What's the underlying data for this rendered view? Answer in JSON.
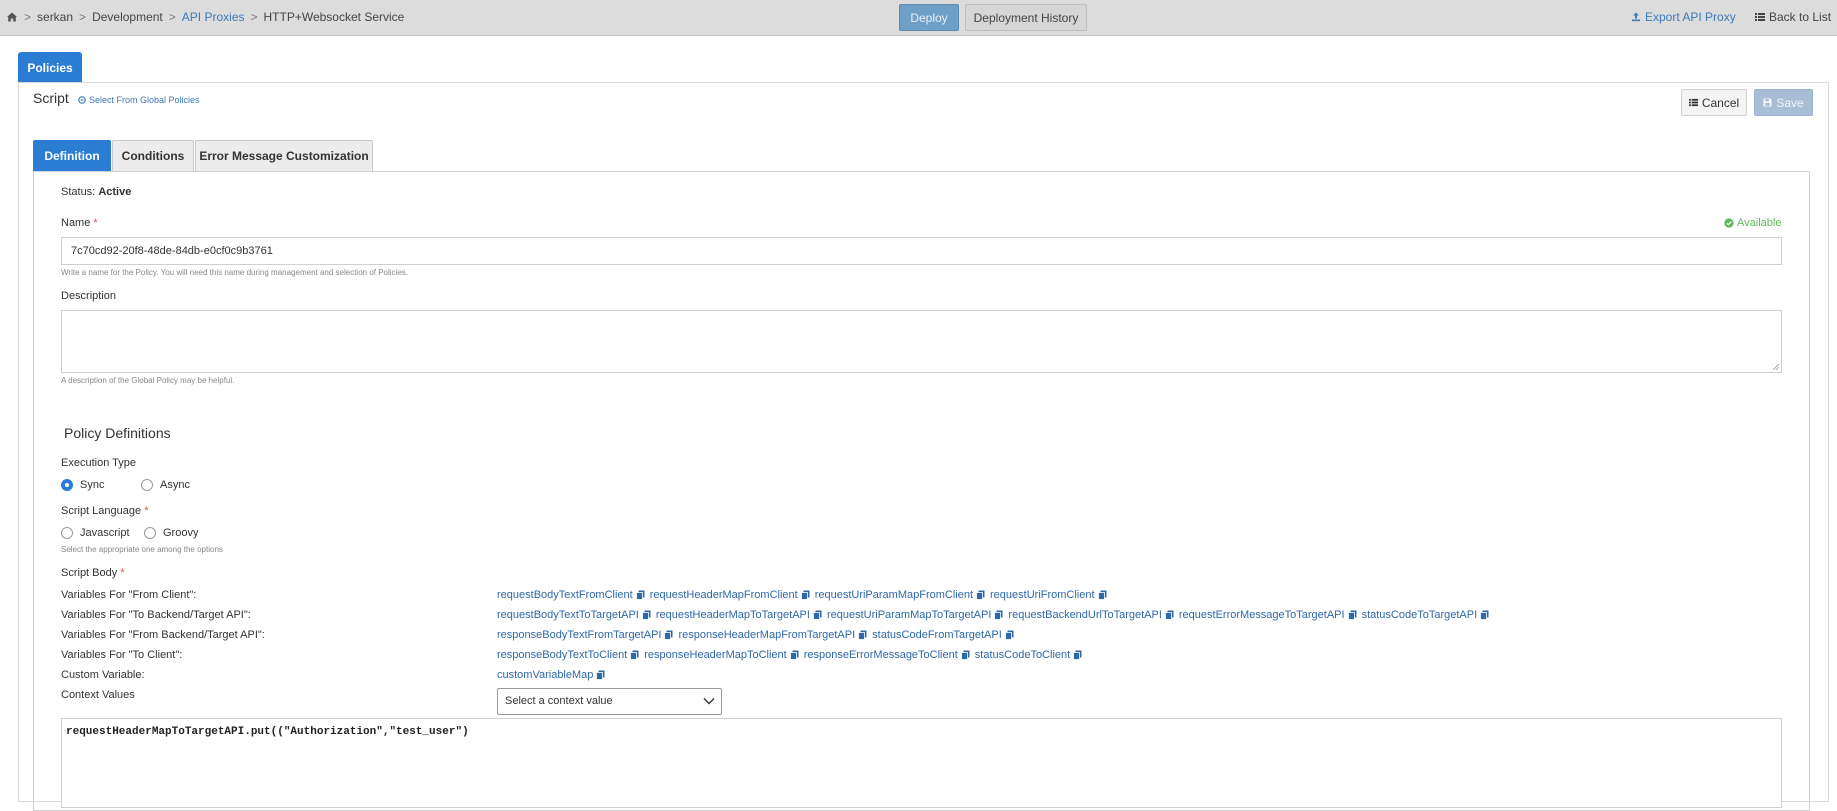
{
  "topbar": {
    "breadcrumb": {
      "workspace": "serkan",
      "environment": "Development",
      "section": "API Proxies",
      "current": "HTTP+Websocket Service"
    },
    "deploy_label": "Deploy",
    "history_label": "Deployment History",
    "export_label": "Export API Proxy",
    "back_label": "Back to List"
  },
  "policies_tab_label": "Policies",
  "header": {
    "title": "Script",
    "global_link": "Select From Global Policies",
    "cancel_label": "Cancel",
    "save_label": "Save"
  },
  "tabs": [
    "Definition",
    "Conditions",
    "Error Message Customization"
  ],
  "form": {
    "status_label": "Status:",
    "status_value": "Active",
    "name_label": "Name",
    "required_mark": "*",
    "available_label": "Available",
    "name_value": "7c70cd92-20f8-48de-84db-e0cf0c9b3761",
    "name_help": "Write a name for the Policy. You will need this name during management and selection of Policies.",
    "description_label": "Description",
    "description_help": "A description of the Global Policy may be helpful."
  },
  "policy_definitions": {
    "title": "Policy Definitions",
    "execution_type_label": "Execution Type",
    "execution_options": [
      "Sync",
      "Async"
    ],
    "execution_selected": "Sync",
    "script_language_label": "Script Language",
    "language_options": [
      "Javascript",
      "Groovy"
    ],
    "language_help": "Select the appropriate one among the options",
    "script_body_label": "Script Body"
  },
  "variables": [
    {
      "label": "Variables For \"From Client\":",
      "items": [
        "requestBodyTextFromClient",
        "requestHeaderMapFromClient",
        "requestUriParamMapFromClient",
        "requestUriFromClient"
      ]
    },
    {
      "label": "Variables For \"To Backend/Target API\":",
      "items": [
        "requestBodyTextToTargetAPI",
        "requestHeaderMapToTargetAPI",
        "requestUriParamMapToTargetAPI",
        "requestBackendUrlToTargetAPI",
        "requestErrorMessageToTargetAPI",
        "statusCodeToTargetAPI"
      ]
    },
    {
      "label": "Variables For \"From Backend/Target API\":",
      "items": [
        "responseBodyTextFromTargetAPI",
        "responseHeaderMapFromTargetAPI",
        "statusCodeFromTargetAPI"
      ]
    },
    {
      "label": "Variables For \"To Client\":",
      "items": [
        "responseBodyTextToClient",
        "responseHeaderMapToClient",
        "responseErrorMessageToClient",
        "statusCodeToClient"
      ]
    },
    {
      "label": "Custom Variable:",
      "items": [
        "customVariableMap"
      ]
    }
  ],
  "context_values": {
    "label": "Context Values",
    "selected": "Select a context value"
  },
  "editor": {
    "code": "requestHeaderMapToTargetAPI.put((\"Authorization\",\"test_user\")"
  },
  "colors": {
    "primary": "#2b7cd3",
    "link": "#2f68a8",
    "success": "#5cb85c",
    "required": "#d9534f"
  }
}
